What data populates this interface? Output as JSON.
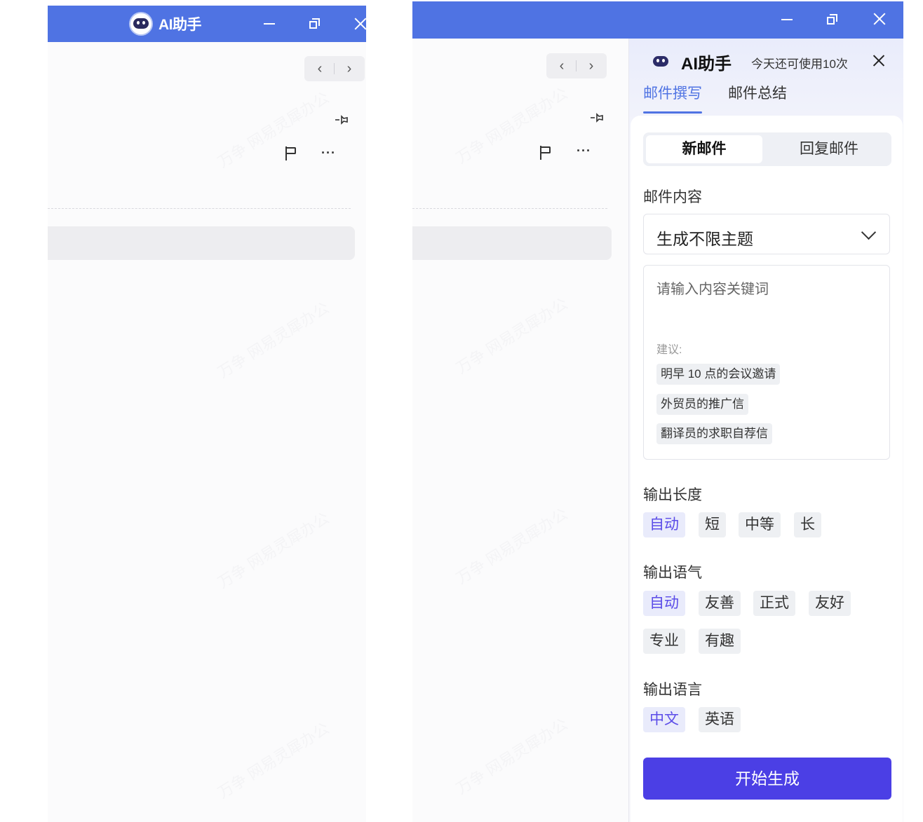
{
  "left_window": {
    "title": "AI助手",
    "nav_prev": "‹",
    "nav_next": "›",
    "more": "···"
  },
  "right_window": {
    "nav_prev": "‹",
    "nav_next": "›",
    "more": "···"
  },
  "panel": {
    "title": "AI助手",
    "usage": "今天还可使用10次",
    "tabs": [
      {
        "label": "邮件撰写",
        "active": true
      },
      {
        "label": "邮件总结",
        "active": false
      }
    ],
    "segments": [
      {
        "label": "新邮件",
        "active": true
      },
      {
        "label": "回复邮件",
        "active": false
      }
    ],
    "content_label": "邮件内容",
    "select_value": "生成不限主题",
    "textarea_placeholder": "请输入内容关键词",
    "suggestion_label": "建议:",
    "suggestions": [
      "明早 10 点的会议邀请",
      "外贸员的推广信",
      "翻译员的求职自荐信"
    ],
    "length": {
      "label": "输出长度",
      "options": [
        "自动",
        "短",
        "中等",
        "长"
      ],
      "selected": "自动"
    },
    "tone": {
      "label": "输出语气",
      "options": [
        "自动",
        "友善",
        "正式",
        "友好",
        "专业",
        "有趣"
      ],
      "selected": "自动"
    },
    "language": {
      "label": "输出语言",
      "options": [
        "中文",
        "英语"
      ],
      "selected": "中文"
    },
    "generate_button": "开始生成"
  },
  "colors": {
    "titlebar": "#4f73e3",
    "accent_tab": "#4f73e3",
    "selected_chip_text": "#5b4ce8",
    "generate_button": "#4b3fe5"
  }
}
